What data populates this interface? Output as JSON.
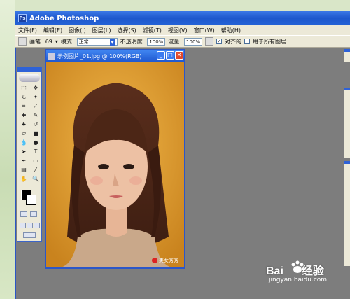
{
  "window": {
    "title": "Adobe Photoshop"
  },
  "menu": {
    "items": [
      "文件(F)",
      "编辑(E)",
      "图像(I)",
      "图层(L)",
      "选择(S)",
      "滤镜(T)",
      "视图(V)",
      "窗口(W)",
      "帮助(H)"
    ]
  },
  "options": {
    "brush_label": "画笔:",
    "brush_size": "69",
    "mode_label": "模式:",
    "mode_value": "正常",
    "opacity_label": "不透明度:",
    "opacity_value": "100%",
    "flow_label": "流量:",
    "flow_value": "100%",
    "aligned_label": "对齐的",
    "all_layers_label": "用于所有图层"
  },
  "document": {
    "title": "示例图片_01.jpg @ 100%(RGB)",
    "watermark": "美女秀秀"
  },
  "toolbox": {
    "text_tool": "T"
  },
  "site_watermark": {
    "brand": "Bai",
    "brand2": "经验",
    "url": "jingyan.baidu.com"
  },
  "colors": {
    "titlebar": "#2563d6",
    "canvas_bg": "#7d7d7d",
    "photo_bg": "#e3a233"
  }
}
